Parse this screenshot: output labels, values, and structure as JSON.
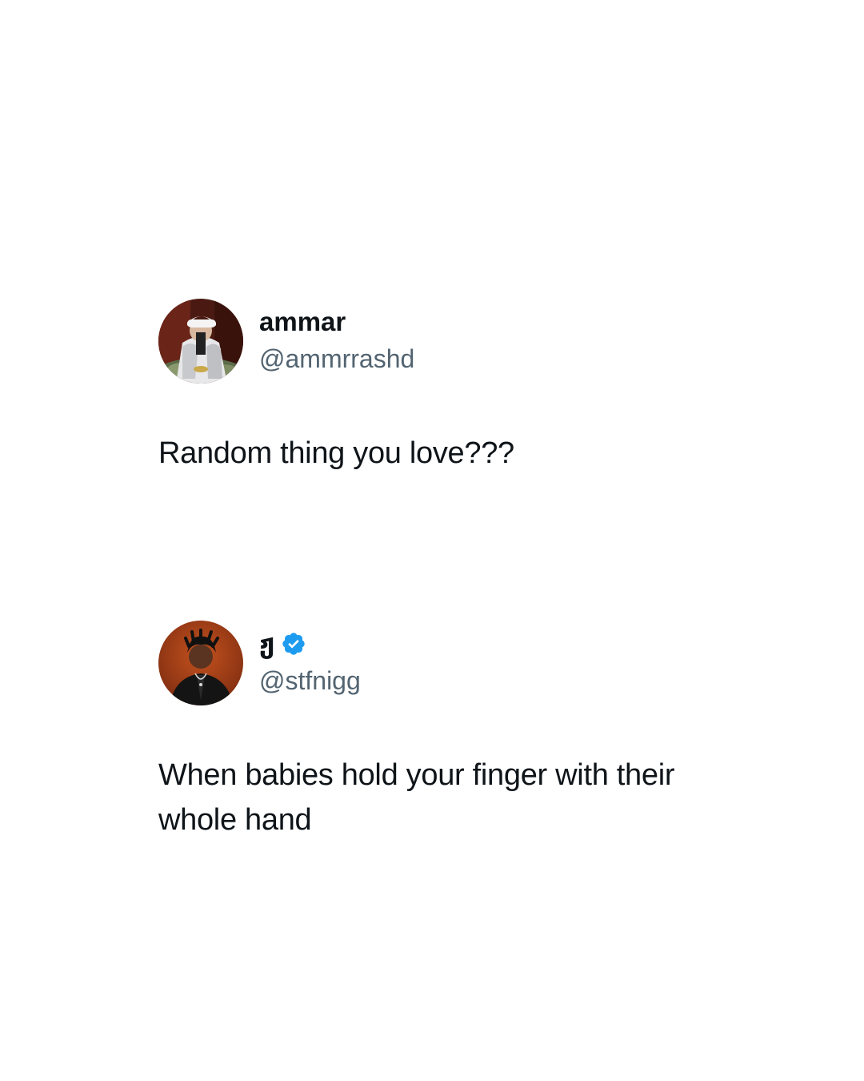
{
  "posts": [
    {
      "display_name": "ammar",
      "handle": "@ammrrashd",
      "text": "Random thing you love???",
      "verified": false,
      "avatar_icon": "profile-photo"
    },
    {
      "display_name": "ჟ",
      "handle": "@stfnigg",
      "text": "When babies hold your finger with their whole hand",
      "verified": true,
      "avatar_icon": "profile-photo"
    }
  ],
  "colors": {
    "background": "#ffffff",
    "text": "#0f1419",
    "handle": "#536471",
    "verified_badge": "#1d9bf0"
  }
}
